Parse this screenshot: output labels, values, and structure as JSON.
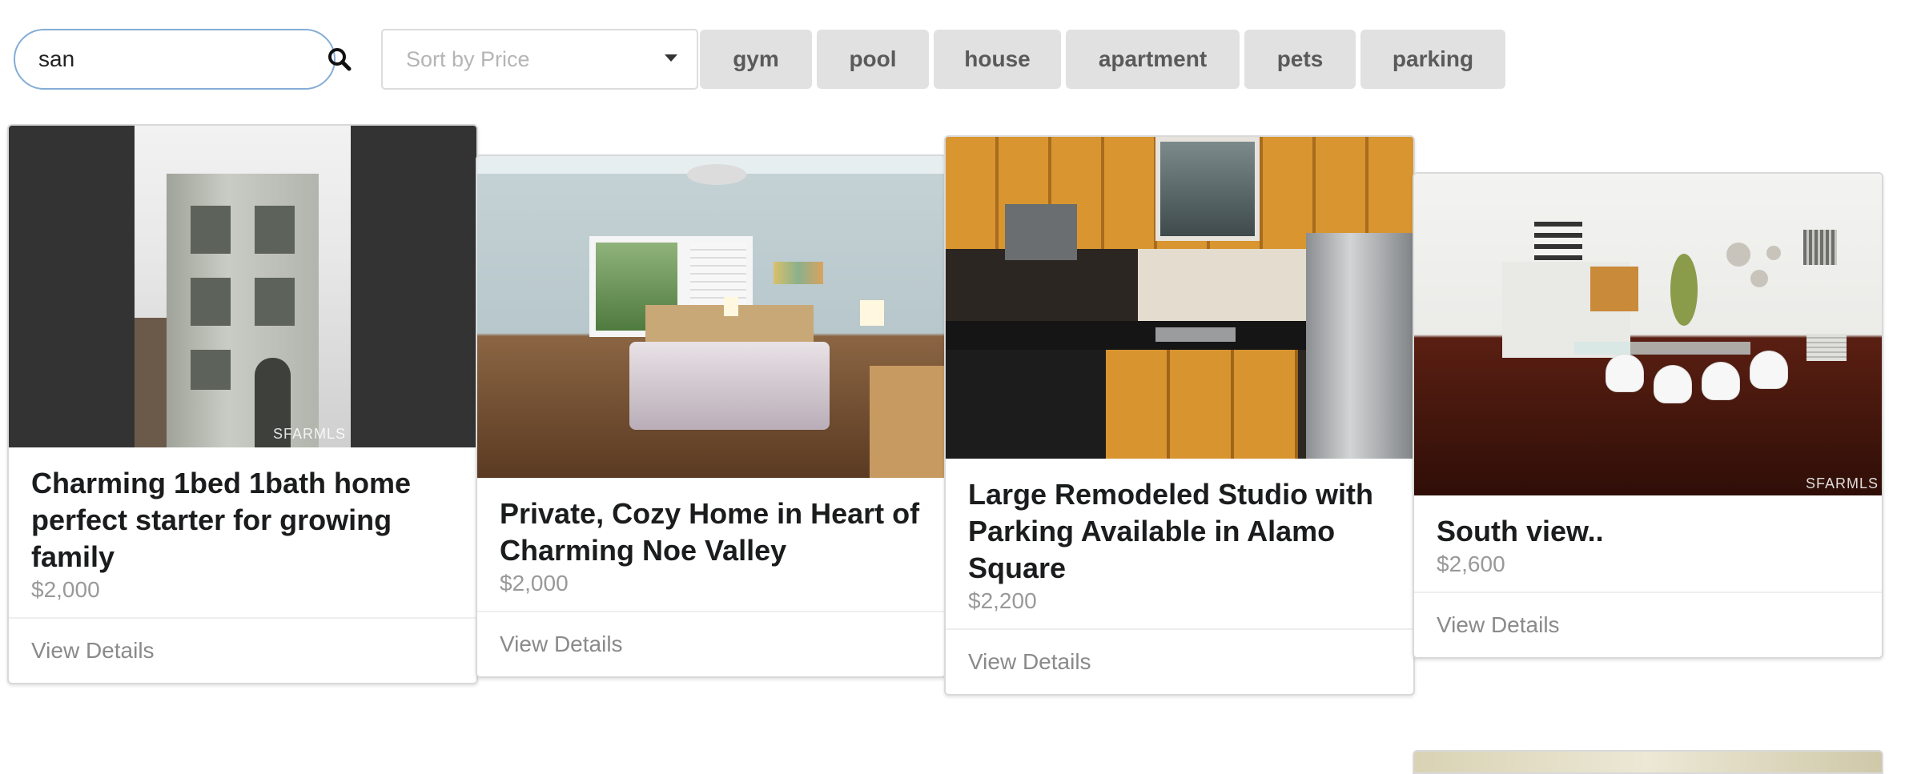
{
  "search": {
    "value": "san",
    "icon": "search-icon"
  },
  "sort": {
    "placeholder": "Sort by Price",
    "icon": "caret-down-icon"
  },
  "filters": [
    {
      "label": "gym"
    },
    {
      "label": "pool"
    },
    {
      "label": "house"
    },
    {
      "label": "apartment"
    },
    {
      "label": "pets"
    },
    {
      "label": "parking"
    }
  ],
  "listings": [
    {
      "title": "Charming 1bed 1bath home perfect starter for growing family",
      "price": "$2,000",
      "action": "View Details",
      "watermark": "SFARMLS"
    },
    {
      "title": "Private, Cozy Home in Heart of Charming Noe Valley",
      "price": "$2,000",
      "action": "View Details"
    },
    {
      "title": "Large Remodeled Studio with Parking Available in Alamo Square",
      "price": "$2,200",
      "action": "View Details"
    },
    {
      "title": "South view..",
      "price": "$2,600",
      "action": "View Details",
      "watermark": "SFARMLS"
    }
  ],
  "colors": {
    "search_border": "#84add6",
    "chip_bg": "#e1e1e2",
    "chip_text": "#5a5a5a",
    "price_text": "#999999",
    "action_text": "#8a8a8a"
  }
}
